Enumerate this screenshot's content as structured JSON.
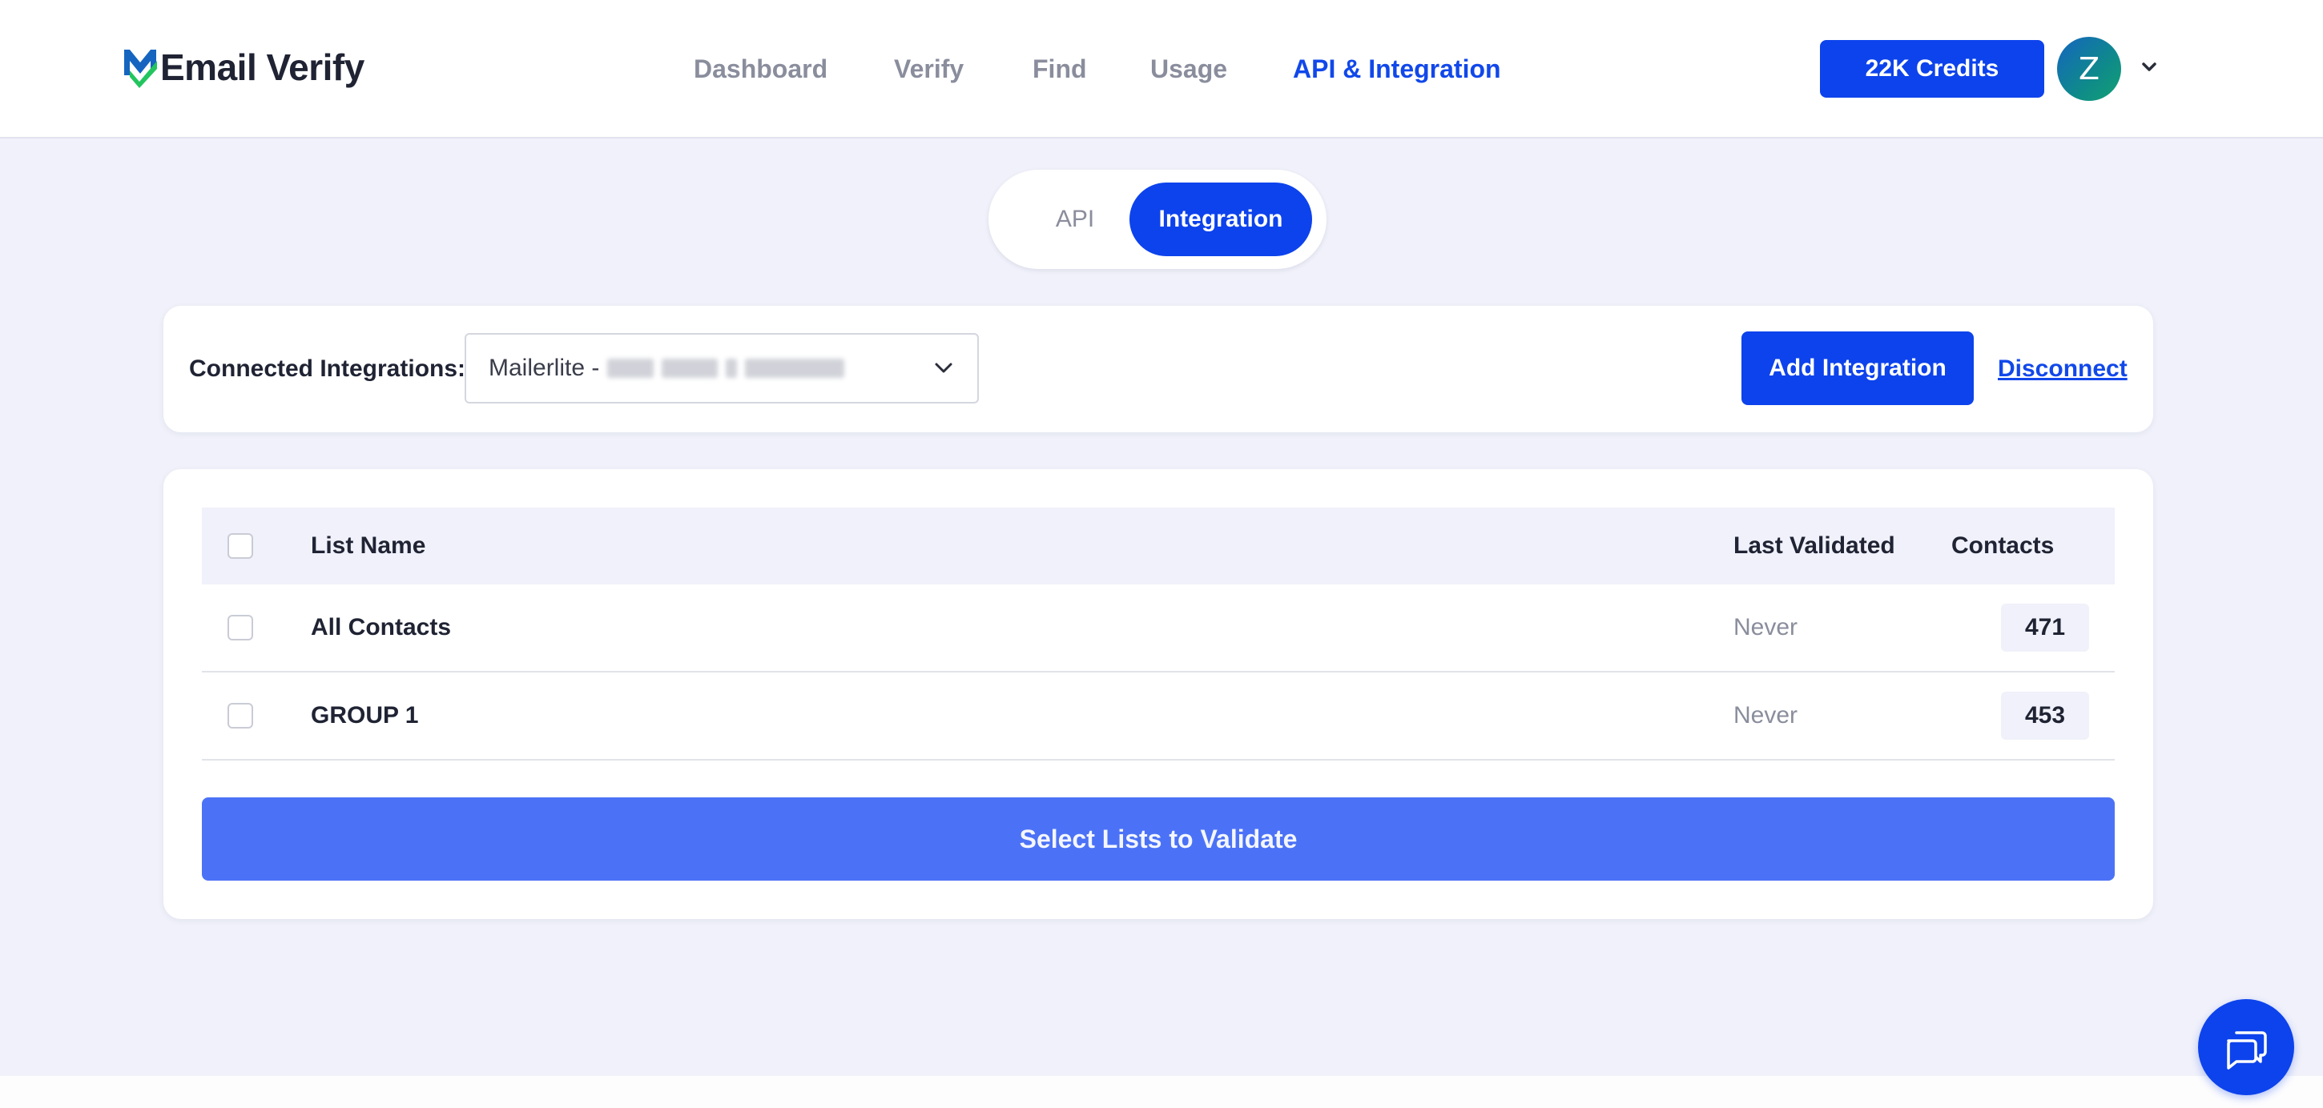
{
  "app": {
    "brand": "Email Verify"
  },
  "nav": {
    "items": [
      {
        "label": "Dashboard"
      },
      {
        "label": "Verify"
      },
      {
        "label": "Find"
      },
      {
        "label": "Usage"
      },
      {
        "label": "API & Integration"
      }
    ],
    "active": "API & Integration"
  },
  "header": {
    "credits_label": "22K Credits",
    "avatar_initial": "Z"
  },
  "toggle": {
    "options": [
      "API",
      "Integration"
    ],
    "selected": "Integration"
  },
  "integrations": {
    "label": "Connected Integrations:",
    "selected_value": "Mailerlite -",
    "add_button": "Add Integration",
    "disconnect_link": "Disconnect"
  },
  "table": {
    "columns": {
      "list_name": "List Name",
      "last_validated": "Last Validated",
      "contacts": "Contacts"
    },
    "rows": [
      {
        "name": "All Contacts",
        "last_validated": "Never",
        "contacts": "471",
        "checked": false
      },
      {
        "name": "GROUP 1",
        "last_validated": "Never",
        "contacts": "453",
        "checked": false
      }
    ],
    "validate_button": "Select Lists to Validate"
  },
  "icons": {
    "logo": "email-verify-logo-icon",
    "avatar_menu": "chevron-down-icon",
    "select_caret": "chevron-down-icon",
    "chat": "chat-bubbles-icon"
  },
  "colors": {
    "primary": "#0d43ec",
    "nav_active": "#1148ea",
    "nav_inactive": "#8a8d9c",
    "page_bg": "#f0f1fa",
    "validate_button": "#4b72f6",
    "logo_blue": "#1565c0",
    "logo_green": "#22c55e"
  }
}
